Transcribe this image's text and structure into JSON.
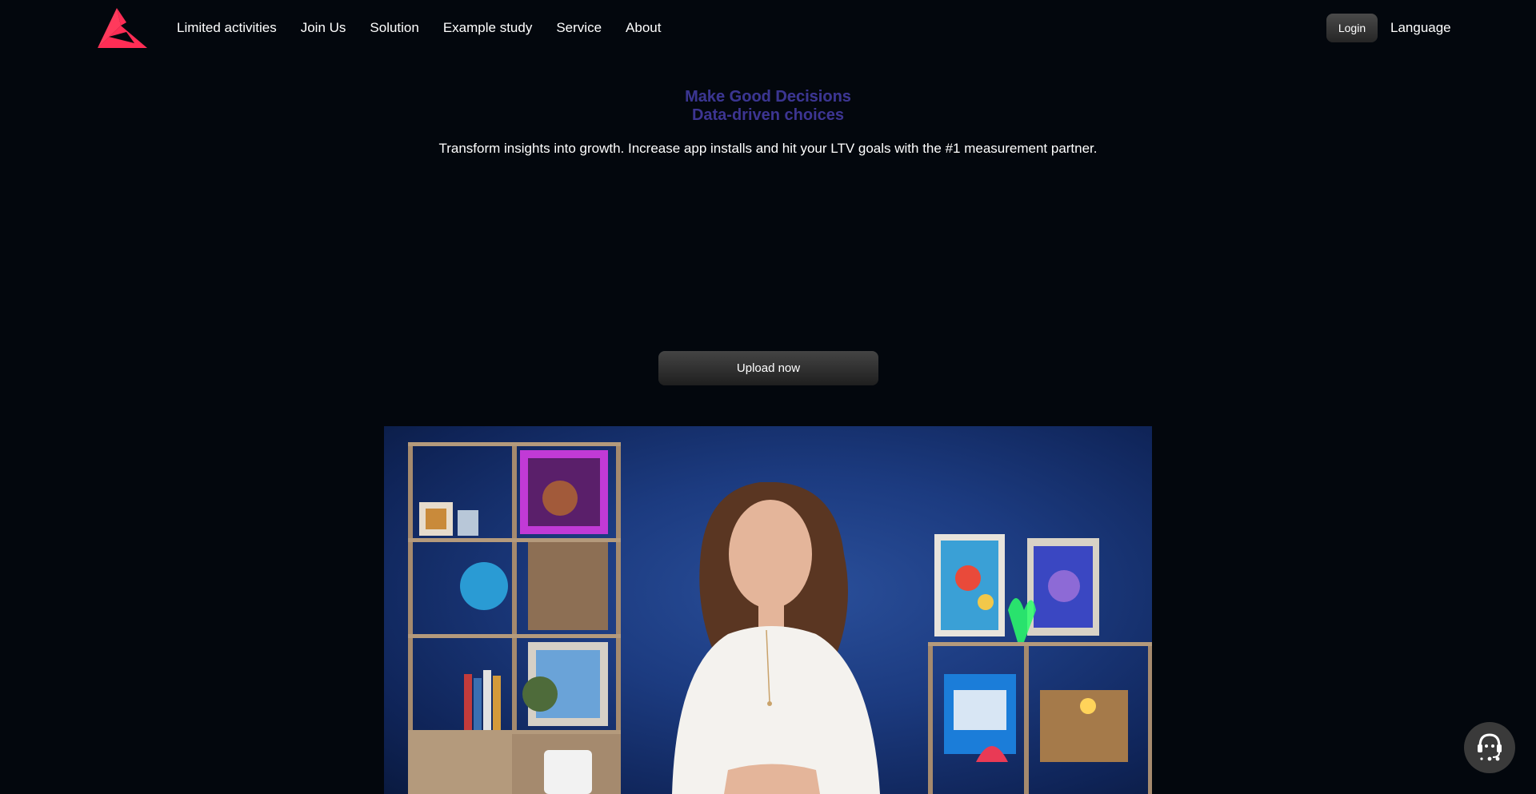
{
  "nav": {
    "items": [
      {
        "label": "Limited activities"
      },
      {
        "label": "Join Us"
      },
      {
        "label": "Solution"
      },
      {
        "label": "Example study"
      },
      {
        "label": "Service"
      },
      {
        "label": "About"
      }
    ],
    "login_label": "Login",
    "language_label": "Language"
  },
  "hero": {
    "title_line1": "Make Good Decisions",
    "title_line2": "Data-driven choices",
    "subtitle": "Transform insights into growth. Increase app installs and hit your LTV goals with the #1 measurement partner.",
    "upload_label": "Upload now"
  },
  "colors": {
    "brand": "#ff2d55",
    "background": "#03070d",
    "title_gradient_start": "#2a3d92",
    "title_gradient_end": "#5a2e8e"
  },
  "icons": {
    "logo": "brand-logo-icon",
    "support": "customer-support-icon"
  }
}
